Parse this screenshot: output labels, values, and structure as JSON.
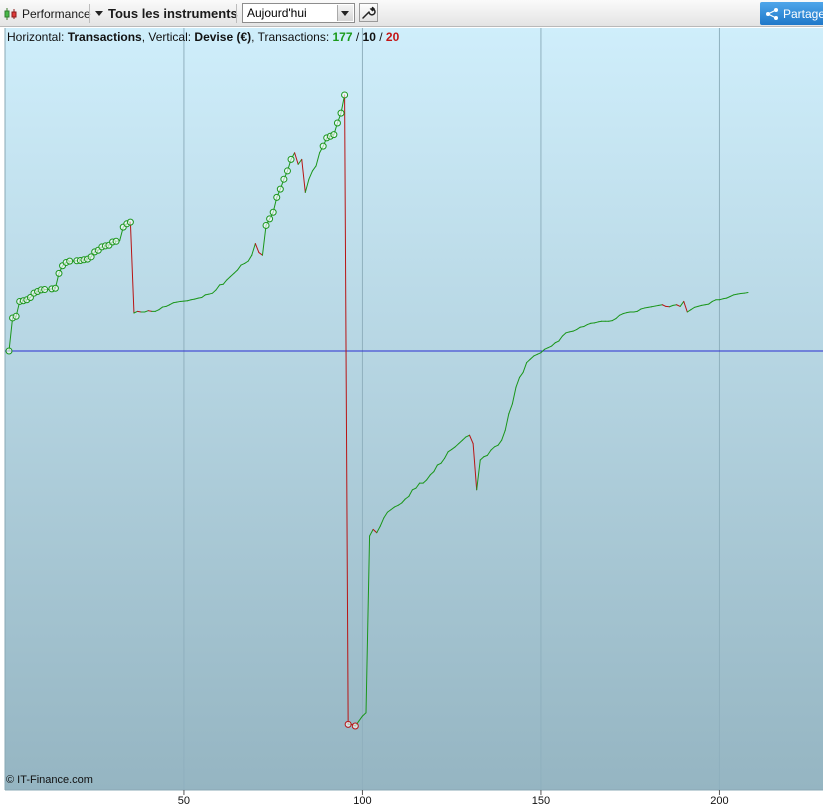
{
  "toolbar": {
    "performance_label": "Performance",
    "instruments_label": "Tous les instruments",
    "period_value": "Aujourd'hui",
    "share_label": "Partager"
  },
  "info": {
    "horizontal_label": "Horizontal: ",
    "horizontal_value": "Transactions",
    "vertical_label": ", Vertical: ",
    "vertical_value": "Devise (€)",
    "transactions_label": ", Transactions: ",
    "count_winning": "177",
    "count_neutral": "10",
    "count_losing": "20",
    "slash": " / "
  },
  "copyright": "© IT-Finance.com",
  "colors": {
    "gain": "#1a961a",
    "loss": "#b81414",
    "zero_line": "#2b2fd0",
    "background_top": "#cfeefb",
    "background_bottom": "#95b5c2",
    "grid": "#8fb0be"
  },
  "chart_data": {
    "type": "line",
    "title": "",
    "xlabel": "Transactions",
    "ylabel": "Devise (€)",
    "xlim": [
      1,
      208
    ],
    "ylim": [
      -1200,
      1050
    ],
    "x_ticks": [
      50,
      100,
      150,
      200
    ],
    "zero_line_y": 0,
    "grid": true,
    "series": [
      {
        "points": [
          [
            1,
            0
          ],
          [
            2,
            100
          ],
          [
            3,
            105
          ],
          [
            4,
            150
          ],
          [
            5,
            152
          ],
          [
            6,
            155
          ],
          [
            7,
            162
          ],
          [
            8,
            175
          ],
          [
            9,
            180
          ],
          [
            10,
            185
          ],
          [
            11,
            186
          ],
          [
            12,
            186
          ],
          [
            13,
            188
          ],
          [
            14,
            190
          ],
          [
            15,
            235
          ],
          [
            16,
            258
          ],
          [
            17,
            268
          ],
          [
            18,
            272
          ],
          [
            19,
            272
          ],
          [
            20,
            273
          ],
          [
            21,
            274
          ],
          [
            22,
            276
          ],
          [
            23,
            278
          ],
          [
            24,
            285
          ],
          [
            25,
            300
          ],
          [
            26,
            305
          ],
          [
            27,
            315
          ],
          [
            28,
            318
          ],
          [
            29,
            320
          ],
          [
            30,
            330
          ],
          [
            31,
            332
          ],
          [
            32,
            334
          ],
          [
            33,
            375
          ],
          [
            34,
            385
          ],
          [
            35,
            390
          ],
          [
            36,
            115
          ],
          [
            37,
            120
          ],
          [
            38,
            118
          ],
          [
            39,
            118
          ],
          [
            40,
            122
          ],
          [
            41,
            120
          ],
          [
            42,
            120
          ],
          [
            43,
            125
          ],
          [
            44,
            133
          ],
          [
            45,
            135
          ],
          [
            46,
            140
          ],
          [
            47,
            146
          ],
          [
            48,
            148
          ],
          [
            49,
            150
          ],
          [
            50,
            151
          ],
          [
            51,
            152
          ],
          [
            52,
            155
          ],
          [
            53,
            157
          ],
          [
            54,
            160
          ],
          [
            55,
            162
          ],
          [
            56,
            170
          ],
          [
            57,
            172
          ],
          [
            58,
            175
          ],
          [
            59,
            185
          ],
          [
            60,
            200
          ],
          [
            61,
            202
          ],
          [
            62,
            215
          ],
          [
            63,
            225
          ],
          [
            64,
            235
          ],
          [
            65,
            245
          ],
          [
            66,
            260
          ],
          [
            67,
            265
          ],
          [
            68,
            272
          ],
          [
            69,
            290
          ],
          [
            70,
            325
          ],
          [
            71,
            298
          ],
          [
            72,
            290
          ],
          [
            73,
            380
          ],
          [
            74,
            400
          ],
          [
            75,
            420
          ],
          [
            76,
            465
          ],
          [
            77,
            490
          ],
          [
            78,
            520
          ],
          [
            79,
            545
          ],
          [
            80,
            580
          ],
          [
            81,
            600
          ],
          [
            82,
            565
          ],
          [
            83,
            580
          ],
          [
            84,
            480
          ],
          [
            85,
            520
          ],
          [
            86,
            545
          ],
          [
            87,
            560
          ],
          [
            88,
            600
          ],
          [
            89,
            620
          ],
          [
            90,
            645
          ],
          [
            91,
            650
          ],
          [
            92,
            655
          ],
          [
            93,
            690
          ],
          [
            94,
            720
          ],
          [
            95,
            775
          ],
          [
            96,
            -1130
          ],
          [
            97,
            -1130
          ],
          [
            98,
            -1135
          ],
          [
            99,
            -1120
          ],
          [
            100,
            -1105
          ],
          [
            101,
            -1095
          ],
          [
            102,
            -560
          ],
          [
            103,
            -540
          ],
          [
            104,
            -550
          ],
          [
            105,
            -530
          ],
          [
            106,
            -505
          ],
          [
            107,
            -488
          ],
          [
            108,
            -480
          ],
          [
            109,
            -472
          ],
          [
            110,
            -467
          ],
          [
            111,
            -460
          ],
          [
            112,
            -448
          ],
          [
            113,
            -440
          ],
          [
            114,
            -420
          ],
          [
            115,
            -415
          ],
          [
            116,
            -400
          ],
          [
            117,
            -400
          ],
          [
            118,
            -390
          ],
          [
            119,
            -375
          ],
          [
            120,
            -365
          ],
          [
            121,
            -345
          ],
          [
            122,
            -340
          ],
          [
            123,
            -325
          ],
          [
            124,
            -305
          ],
          [
            125,
            -298
          ],
          [
            126,
            -290
          ],
          [
            127,
            -280
          ],
          [
            128,
            -270
          ],
          [
            129,
            -260
          ],
          [
            130,
            -255
          ],
          [
            131,
            -280
          ],
          [
            132,
            -420
          ],
          [
            133,
            -330
          ],
          [
            134,
            -320
          ],
          [
            135,
            -316
          ],
          [
            136,
            -300
          ],
          [
            137,
            -290
          ],
          [
            138,
            -285
          ],
          [
            139,
            -270
          ],
          [
            140,
            -240
          ],
          [
            141,
            -190
          ],
          [
            142,
            -160
          ],
          [
            143,
            -110
          ],
          [
            144,
            -80
          ],
          [
            145,
            -65
          ],
          [
            146,
            -35
          ],
          [
            147,
            -25
          ],
          [
            148,
            -15
          ],
          [
            149,
            -10
          ],
          [
            150,
            -5
          ],
          [
            151,
            5
          ],
          [
            152,
            10
          ],
          [
            153,
            15
          ],
          [
            154,
            25
          ],
          [
            155,
            30
          ],
          [
            156,
            45
          ],
          [
            157,
            55
          ],
          [
            158,
            58
          ],
          [
            159,
            60
          ],
          [
            160,
            65
          ],
          [
            161,
            72
          ],
          [
            162,
            74
          ],
          [
            163,
            80
          ],
          [
            164,
            84
          ],
          [
            165,
            85
          ],
          [
            166,
            88
          ],
          [
            167,
            90
          ],
          [
            168,
            90
          ],
          [
            169,
            90
          ],
          [
            170,
            92
          ],
          [
            171,
            98
          ],
          [
            172,
            108
          ],
          [
            173,
            113
          ],
          [
            174,
            116
          ],
          [
            175,
            118
          ],
          [
            176,
            118
          ],
          [
            177,
            120
          ],
          [
            178,
            127
          ],
          [
            179,
            130
          ],
          [
            180,
            132
          ],
          [
            181,
            134
          ],
          [
            182,
            136
          ],
          [
            183,
            138
          ],
          [
            184,
            140
          ],
          [
            185,
            135
          ],
          [
            186,
            134
          ],
          [
            187,
            138
          ],
          [
            188,
            140
          ],
          [
            189,
            135
          ],
          [
            190,
            150
          ],
          [
            191,
            118
          ],
          [
            192,
            125
          ],
          [
            193,
            132
          ],
          [
            194,
            135
          ],
          [
            195,
            138
          ],
          [
            196,
            140
          ],
          [
            197,
            142
          ],
          [
            198,
            150
          ],
          [
            199,
            155
          ],
          [
            200,
            155
          ],
          [
            201,
            158
          ],
          [
            202,
            160
          ],
          [
            203,
            165
          ],
          [
            204,
            170
          ],
          [
            205,
            172
          ],
          [
            206,
            174
          ],
          [
            207,
            175
          ],
          [
            208,
            177
          ]
        ]
      }
    ],
    "peak_markers": [
      [
        1,
        0
      ],
      [
        2,
        100
      ],
      [
        3,
        105
      ],
      [
        4,
        150
      ],
      [
        5,
        152
      ],
      [
        6,
        155
      ],
      [
        7,
        162
      ],
      [
        8,
        175
      ],
      [
        9,
        180
      ],
      [
        10,
        185
      ],
      [
        11,
        186
      ],
      [
        13,
        188
      ],
      [
        14,
        190
      ],
      [
        15,
        235
      ],
      [
        16,
        258
      ],
      [
        17,
        268
      ],
      [
        18,
        272
      ],
      [
        20,
        273
      ],
      [
        21,
        274
      ],
      [
        22,
        276
      ],
      [
        23,
        278
      ],
      [
        24,
        285
      ],
      [
        25,
        300
      ],
      [
        26,
        305
      ],
      [
        27,
        315
      ],
      [
        28,
        318
      ],
      [
        29,
        320
      ],
      [
        30,
        330
      ],
      [
        31,
        332
      ],
      [
        33,
        375
      ],
      [
        34,
        385
      ],
      [
        35,
        390
      ],
      [
        73,
        380
      ],
      [
        74,
        400
      ],
      [
        75,
        420
      ],
      [
        76,
        465
      ],
      [
        77,
        490
      ],
      [
        78,
        520
      ],
      [
        79,
        545
      ],
      [
        80,
        580
      ],
      [
        89,
        620
      ],
      [
        90,
        645
      ],
      [
        91,
        650
      ],
      [
        92,
        655
      ],
      [
        93,
        690
      ],
      [
        94,
        720
      ],
      [
        95,
        775
      ]
    ],
    "trough_markers": [
      [
        96,
        -1130
      ],
      [
        98,
        -1135
      ]
    ]
  }
}
